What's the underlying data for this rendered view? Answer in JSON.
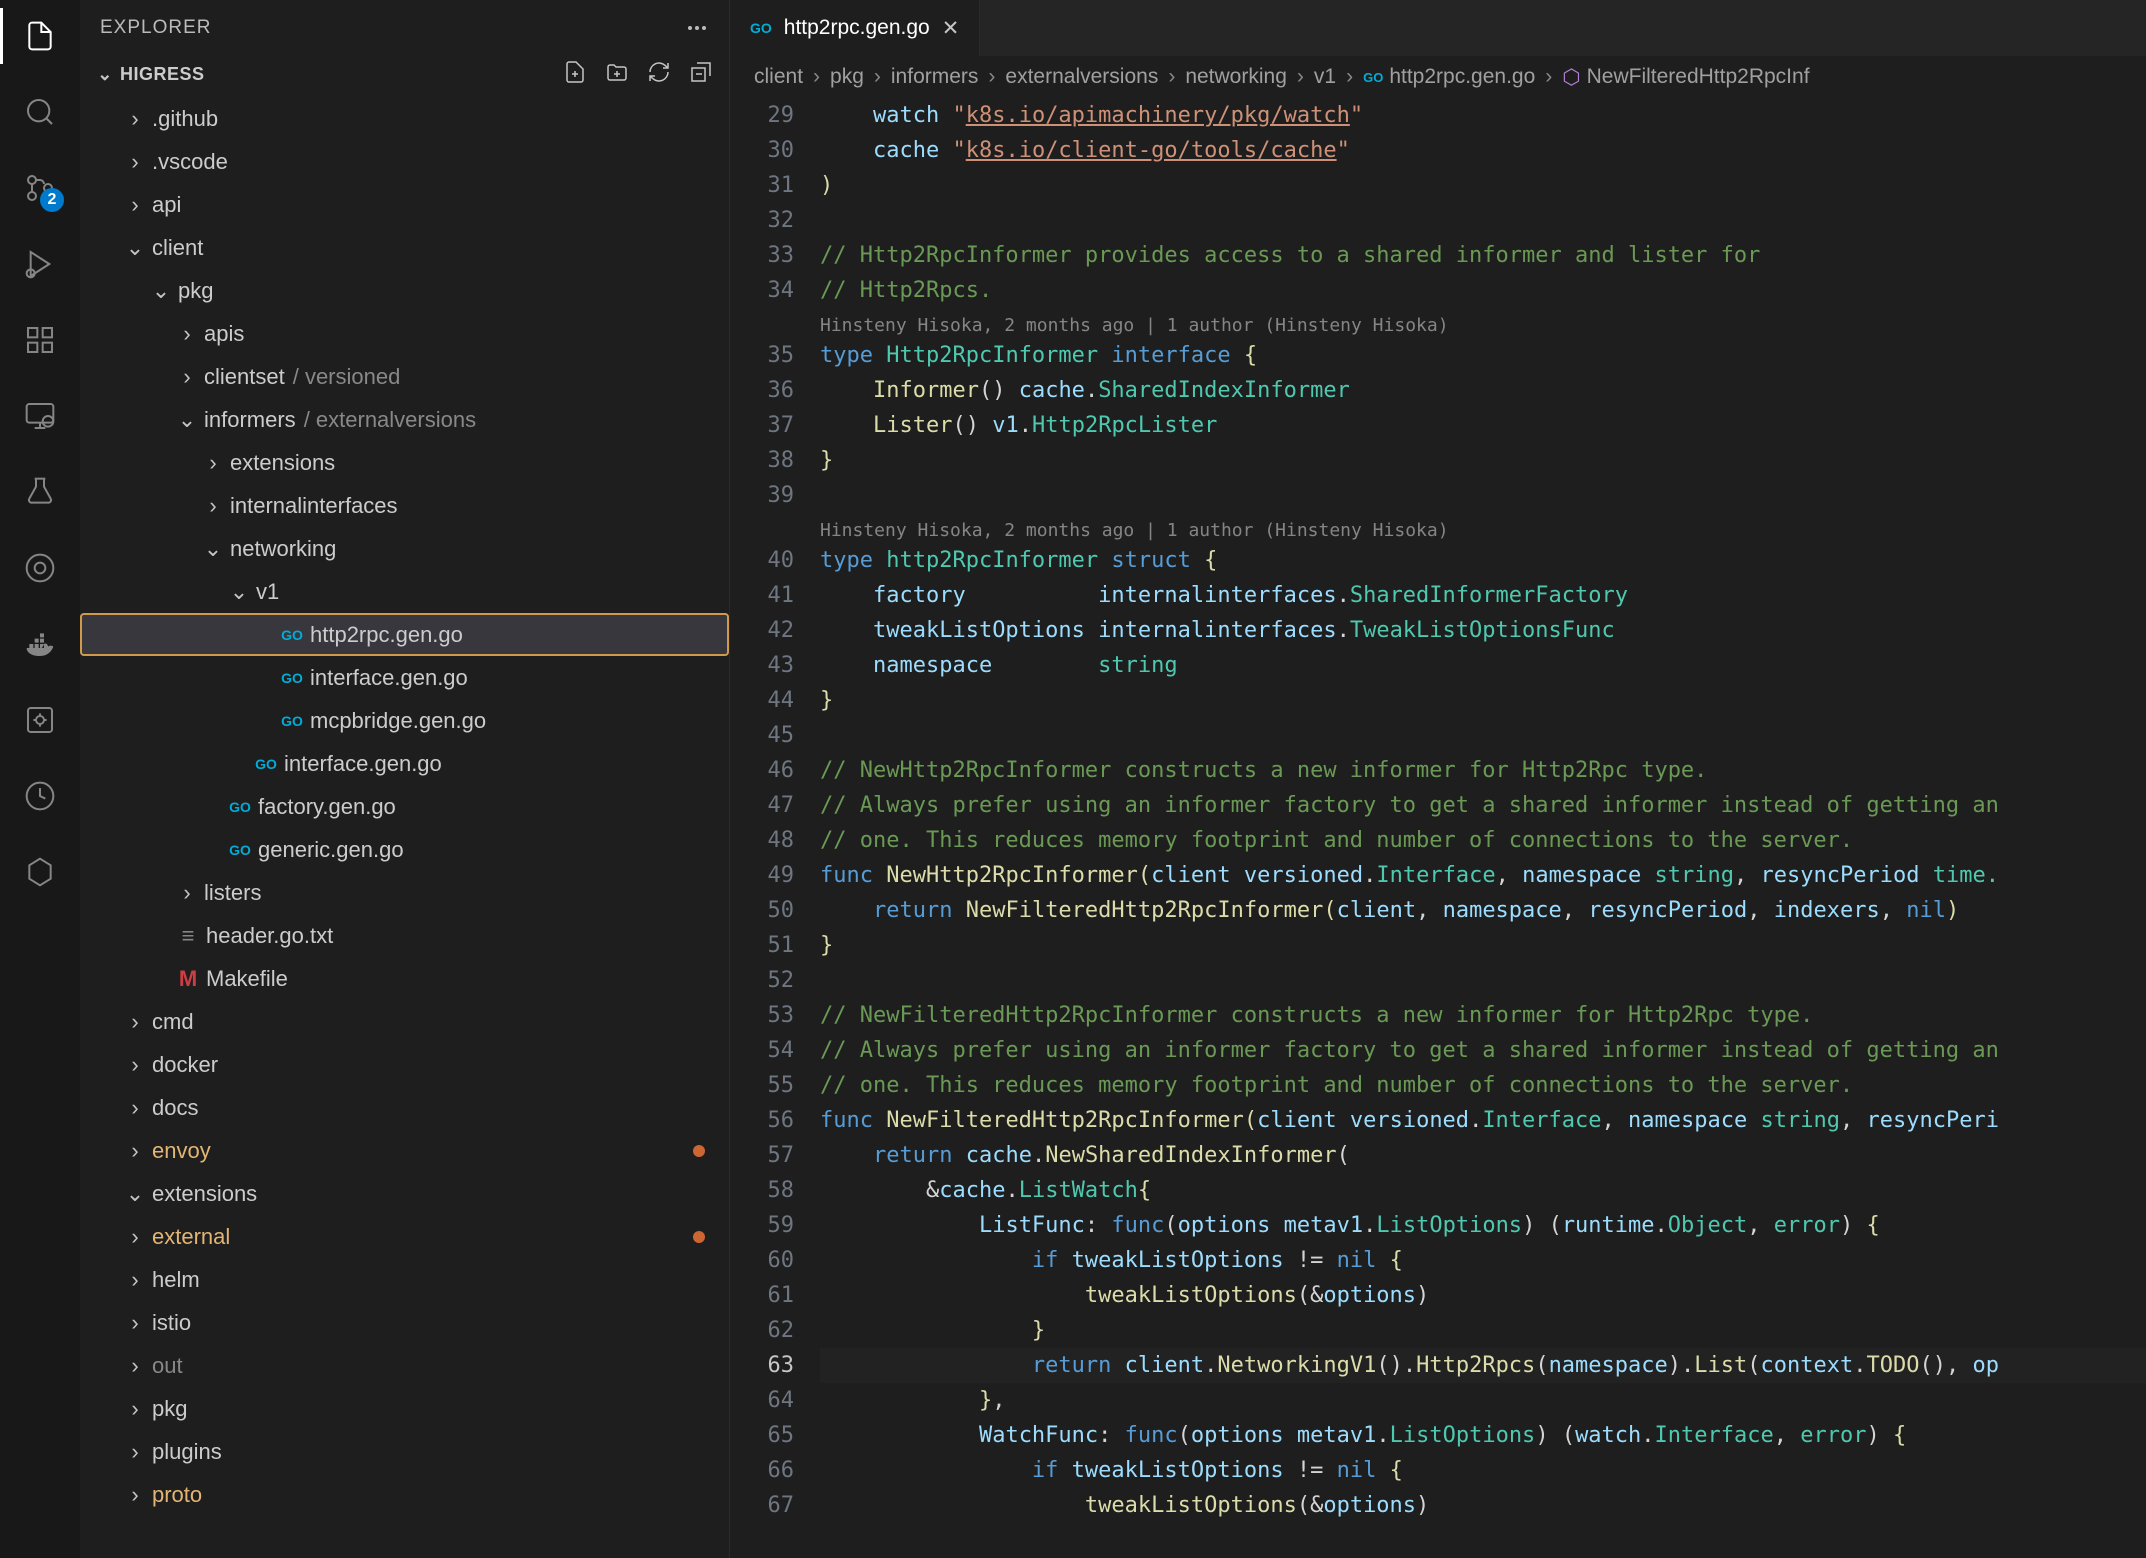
{
  "activityBar": {
    "badge": "2"
  },
  "sidebar": {
    "title": "EXPLORER",
    "section": "HIGRESS",
    "tree": [
      {
        "label": ".github",
        "depth": 1,
        "kind": "folder",
        "state": "closed"
      },
      {
        "label": ".vscode",
        "depth": 1,
        "kind": "folder",
        "state": "closed"
      },
      {
        "label": "api",
        "depth": 1,
        "kind": "folder",
        "state": "closed"
      },
      {
        "label": "client",
        "depth": 1,
        "kind": "folder",
        "state": "open"
      },
      {
        "label": "pkg",
        "depth": 2,
        "kind": "folder",
        "state": "open"
      },
      {
        "label": "apis",
        "depth": 3,
        "kind": "folder",
        "state": "closed"
      },
      {
        "label": "clientset",
        "extra": "versioned",
        "depth": 3,
        "kind": "folder",
        "state": "closed"
      },
      {
        "label": "informers",
        "extra": "externalversions",
        "depth": 3,
        "kind": "folder",
        "state": "open"
      },
      {
        "label": "extensions",
        "depth": 4,
        "kind": "folder",
        "state": "closed"
      },
      {
        "label": "internalinterfaces",
        "depth": 4,
        "kind": "folder",
        "state": "closed"
      },
      {
        "label": "networking",
        "depth": 4,
        "kind": "folder",
        "state": "open"
      },
      {
        "label": "v1",
        "depth": 5,
        "kind": "folder",
        "state": "open"
      },
      {
        "label": "http2rpc.gen.go",
        "depth": 6,
        "kind": "go",
        "selected": true
      },
      {
        "label": "interface.gen.go",
        "depth": 6,
        "kind": "go"
      },
      {
        "label": "mcpbridge.gen.go",
        "depth": 6,
        "kind": "go"
      },
      {
        "label": "interface.gen.go",
        "depth": 5,
        "kind": "go"
      },
      {
        "label": "factory.gen.go",
        "depth": 4,
        "kind": "go"
      },
      {
        "label": "generic.gen.go",
        "depth": 4,
        "kind": "go"
      },
      {
        "label": "listers",
        "depth": 3,
        "kind": "folder",
        "state": "closed"
      },
      {
        "label": "header.go.txt",
        "depth": 2,
        "kind": "txt"
      },
      {
        "label": "Makefile",
        "depth": 2,
        "kind": "mk"
      },
      {
        "label": "cmd",
        "depth": 1,
        "kind": "folder",
        "state": "closed"
      },
      {
        "label": "docker",
        "depth": 1,
        "kind": "folder",
        "state": "closed"
      },
      {
        "label": "docs",
        "depth": 1,
        "kind": "folder",
        "state": "closed"
      },
      {
        "label": "envoy",
        "depth": 1,
        "kind": "folder",
        "state": "closed",
        "cls": "orange",
        "dot": true
      },
      {
        "label": "extensions",
        "depth": 1,
        "kind": "folder",
        "state": "open"
      },
      {
        "label": "external",
        "depth": 1,
        "kind": "folder",
        "state": "closed",
        "cls": "orange",
        "dot": true
      },
      {
        "label": "helm",
        "depth": 1,
        "kind": "folder",
        "state": "closed"
      },
      {
        "label": "istio",
        "depth": 1,
        "kind": "folder",
        "state": "closed"
      },
      {
        "label": "out",
        "depth": 1,
        "kind": "folder",
        "state": "closed",
        "cls": "muted"
      },
      {
        "label": "pkg",
        "depth": 1,
        "kind": "folder",
        "state": "closed"
      },
      {
        "label": "plugins",
        "depth": 1,
        "kind": "folder",
        "state": "closed"
      },
      {
        "label": "proto",
        "depth": 1,
        "kind": "folder",
        "state": "closed",
        "cls": "orange"
      }
    ]
  },
  "editor": {
    "tab": {
      "label": "http2rpc.gen.go"
    },
    "breadcrumb": [
      "client",
      "pkg",
      "informers",
      "externalversions",
      "networking",
      "v1",
      "http2rpc.gen.go",
      "NewFilteredHttp2RpcInf"
    ],
    "lens1": "Hinsteny Hisoka, 2 months ago | 1 author (Hinsteny Hisoka)",
    "lens2": "Hinsteny Hisoka, 2 months ago | 1 author (Hinsteny Hisoka)",
    "lineStart": 29,
    "lines": [
      {
        "n": 29,
        "html": "    <span class='v'>watch</span> <span class='s'>\"</span><span class='s-u'>k8s.io/apimachinery/pkg/watch</span><span class='s'>\"</span>"
      },
      {
        "n": 30,
        "html": "    <span class='v'>cache</span> <span class='s'>\"</span><span class='s-u'>k8s.io/client-go/tools/cache</span><span class='s'>\"</span>"
      },
      {
        "n": 31,
        "html": "<span class='y'>)</span>"
      },
      {
        "n": 32,
        "html": ""
      },
      {
        "n": 33,
        "html": "<span class='c'>// Http2RpcInformer provides access to a shared informer and lister for</span>"
      },
      {
        "n": 34,
        "html": "<span class='c'>// Http2Rpcs.</span>"
      },
      {
        "lens": "lens1"
      },
      {
        "n": 35,
        "html": "<span class='k'>type</span> <span class='t'>Http2RpcInformer</span> <span class='k'>interface</span> <span class='y'>{</span>"
      },
      {
        "n": 36,
        "html": "    <span class='fn'>Informer</span><span class='p'>()</span> <span class='v'>cache</span><span class='p'>.</span><span class='t'>SharedIndexInformer</span>"
      },
      {
        "n": 37,
        "html": "    <span class='fn'>Lister</span><span class='p'>()</span> <span class='v'>v1</span><span class='p'>.</span><span class='t'>Http2RpcLister</span>"
      },
      {
        "n": 38,
        "html": "<span class='y'>}</span>"
      },
      {
        "n": 39,
        "html": ""
      },
      {
        "lens": "lens2"
      },
      {
        "n": 40,
        "html": "<span class='k'>type</span> <span class='t'>http2RpcInformer</span> <span class='k'>struct</span> <span class='y'>{</span>"
      },
      {
        "n": 41,
        "html": "    <span class='v'>factory</span>          <span class='v'>internalinterfaces</span><span class='p'>.</span><span class='t'>SharedInformerFactory</span>"
      },
      {
        "n": 42,
        "html": "    <span class='v'>tweakListOptions</span> <span class='v'>internalinterfaces</span><span class='p'>.</span><span class='t'>TweakListOptionsFunc</span>"
      },
      {
        "n": 43,
        "html": "    <span class='v'>namespace</span>        <span class='t'>string</span>"
      },
      {
        "n": 44,
        "html": "<span class='y'>}</span>"
      },
      {
        "n": 45,
        "html": ""
      },
      {
        "n": 46,
        "html": "<span class='c'>// NewHttp2RpcInformer constructs a new informer for Http2Rpc type.</span>"
      },
      {
        "n": 47,
        "html": "<span class='c'>// Always prefer using an informer factory to get a shared informer instead of getting an</span>"
      },
      {
        "n": 48,
        "html": "<span class='c'>// one. This reduces memory footprint and number of connections to the server.</span>"
      },
      {
        "n": 49,
        "html": "<span class='k'>func</span> <span class='fn'>NewHttp2RpcInformer</span><span class='y'>(</span><span class='v'>client</span> <span class='v'>versioned</span><span class='p'>.</span><span class='t'>Interface</span><span class='p'>,</span> <span class='v'>namespace</span> <span class='t'>string</span><span class='p'>,</span> <span class='v'>resyncPeriod</span> <span class='t'>time.</span>"
      },
      {
        "n": 50,
        "html": "    <span class='k'>return</span> <span class='fn'>NewFilteredHttp2RpcInformer</span><span class='y'>(</span><span class='v'>client</span><span class='p'>,</span> <span class='v'>namespace</span><span class='p'>,</span> <span class='v'>resyncPeriod</span><span class='p'>,</span> <span class='v'>indexers</span><span class='p'>,</span> <span class='k'>nil</span><span class='y'>)</span>"
      },
      {
        "n": 51,
        "html": "<span class='y'>}</span>"
      },
      {
        "n": 52,
        "html": ""
      },
      {
        "n": 53,
        "html": "<span class='c'>// NewFilteredHttp2RpcInformer constructs a new informer for Http2Rpc type.</span>"
      },
      {
        "n": 54,
        "html": "<span class='c'>// Always prefer using an informer factory to get a shared informer instead of getting an</span>"
      },
      {
        "n": 55,
        "html": "<span class='c'>// one. This reduces memory footprint and number of connections to the server.</span>"
      },
      {
        "n": 56,
        "html": "<span class='k'>func</span> <span class='fn'>NewFilteredHttp2RpcInformer</span><span class='y'>(</span><span class='v'>client</span> <span class='v'>versioned</span><span class='p'>.</span><span class='t'>Interface</span><span class='p'>,</span> <span class='v'>namespace</span> <span class='t'>string</span><span class='p'>,</span> <span class='v'>resyncPeri</span>"
      },
      {
        "n": 57,
        "html": "    <span class='k'>return</span> <span class='v'>cache</span><span class='p'>.</span><span class='fn'>NewSharedIndexInformer</span><span class='p'>(</span>"
      },
      {
        "n": 58,
        "html": "        <span class='p'>&amp;</span><span class='v'>cache</span><span class='p'>.</span><span class='t'>ListWatch</span><span class='y'>{</span>"
      },
      {
        "n": 59,
        "html": "            <span class='v'>ListFunc</span><span class='p'>:</span> <span class='k'>func</span><span class='p'>(</span><span class='v'>options</span> <span class='v'>metav1</span><span class='p'>.</span><span class='t'>ListOptions</span><span class='p'>)</span> <span class='p'>(</span><span class='v'>runtime</span><span class='p'>.</span><span class='t'>Object</span><span class='p'>,</span> <span class='t'>error</span><span class='p'>)</span> <span class='y'>{</span>"
      },
      {
        "n": 60,
        "html": "                <span class='k'>if</span> <span class='v'>tweakListOptions</span> <span class='p'>!=</span> <span class='k'>nil</span> <span class='y'>{</span>"
      },
      {
        "n": 61,
        "html": "                    <span class='fn'>tweakListOptions</span><span class='p'>(&amp;</span><span class='v'>options</span><span class='p'>)</span>"
      },
      {
        "n": 62,
        "html": "                <span class='y'>}</span>"
      },
      {
        "n": 63,
        "html": "                <span class='k'>return</span> <span class='v'>client</span><span class='p'>.</span><span class='fn'>NetworkingV1</span><span class='p'>().</span><span class='fn'>Http2Rpcs</span><span class='p'>(</span><span class='v'>namespace</span><span class='p'>).</span><span class='fn'>List</span><span class='p'>(</span><span class='v'>context</span><span class='p'>.</span><span class='fn'>TODO</span><span class='p'>(),</span> <span class='v'>op</span>",
        "cur": true
      },
      {
        "n": 64,
        "html": "            <span class='y'>}</span><span class='p'>,</span>"
      },
      {
        "n": 65,
        "html": "            <span class='v'>WatchFunc</span><span class='p'>:</span> <span class='k'>func</span><span class='p'>(</span><span class='v'>options</span> <span class='v'>metav1</span><span class='p'>.</span><span class='t'>ListOptions</span><span class='p'>)</span> <span class='p'>(</span><span class='v'>watch</span><span class='p'>.</span><span class='t'>Interface</span><span class='p'>,</span> <span class='t'>error</span><span class='p'>)</span> <span class='y'>{</span>"
      },
      {
        "n": 66,
        "html": "                <span class='k'>if</span> <span class='v'>tweakListOptions</span> <span class='p'>!=</span> <span class='k'>nil</span> <span class='y'>{</span>"
      },
      {
        "n": 67,
        "html": "                    <span class='fn'>tweakListOptions</span><span class='p'>(&amp;</span><span class='v'>options</span><span class='p'>)</span>"
      }
    ]
  }
}
